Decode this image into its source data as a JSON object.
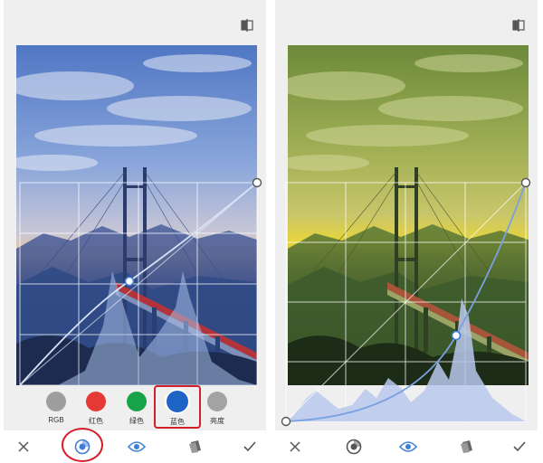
{
  "colors": {
    "accent": "#3f7fd3",
    "annotation_red": "#d31f2a",
    "grid_line": "#ffffff",
    "curve_line": "#c8d6f2",
    "sheet_bg": "#efefef"
  },
  "left_screen": {
    "compare_icon": "compare-split-icon",
    "channels": [
      {
        "id": "rgb",
        "label": "RGB",
        "color": "#9e9e9e",
        "selected": false
      },
      {
        "id": "red",
        "label": "红色",
        "color": "#e53935",
        "selected": false
      },
      {
        "id": "green",
        "label": "绿色",
        "color": "#16a34a",
        "selected": false
      },
      {
        "id": "blue",
        "label": "蓝色",
        "color": "#1e63c6",
        "selected": true
      },
      {
        "id": "luminance",
        "label": "亮度",
        "color": "#a3a3a3",
        "selected": false
      }
    ],
    "toolbar": [
      "close-icon",
      "curves-preset-icon",
      "eye-icon",
      "styles-icon",
      "check-icon"
    ],
    "active_tool": "curves-preset-icon"
  },
  "right_screen": {
    "compare_icon": "compare-split-icon",
    "toolbar": [
      "close-icon",
      "curves-preset-icon",
      "eye-icon",
      "styles-icon",
      "check-icon"
    ],
    "active_tool": "eye-icon"
  }
}
